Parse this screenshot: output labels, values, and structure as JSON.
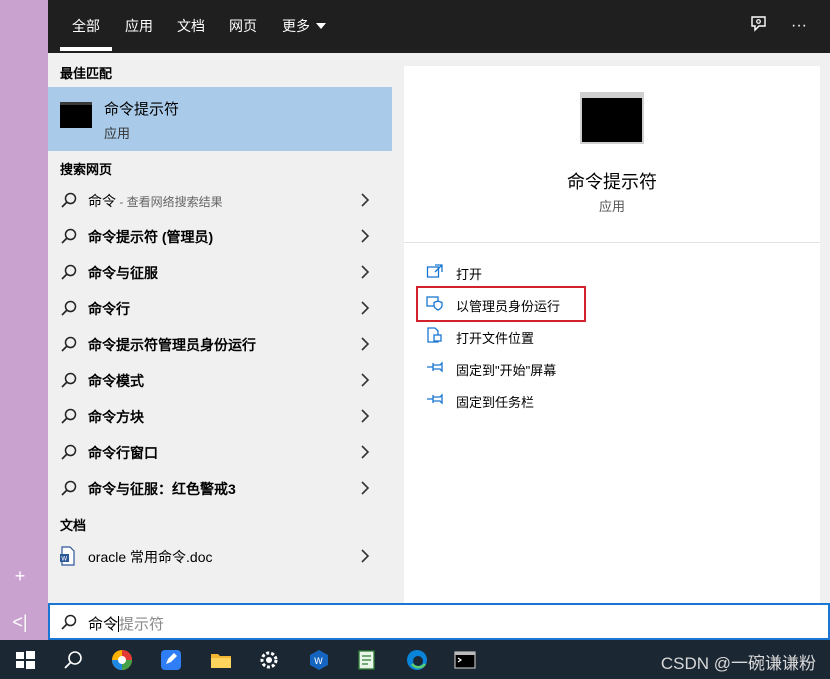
{
  "tabs": [
    {
      "label": "全部",
      "active": true
    },
    {
      "label": "应用"
    },
    {
      "label": "文档"
    },
    {
      "label": "网页"
    },
    {
      "label": "更多"
    }
  ],
  "top_icons": [
    "feedback-icon",
    "more-options-icon"
  ],
  "more_label": "···",
  "sections": {
    "best_match": "最佳匹配",
    "web": "搜索网页",
    "docs": "文档"
  },
  "best_match": {
    "title": "命令提示符",
    "subtitle": "应用"
  },
  "web_results": [
    {
      "text": "命令",
      "hint": " - 查看网络搜索结果"
    },
    {
      "text": "命令提示符 (管理员)"
    },
    {
      "text": "命令与征服"
    },
    {
      "text": "命令行"
    },
    {
      "text": "命令提示符管理员身份运行"
    },
    {
      "text": "命令模式"
    },
    {
      "text": "命令方块"
    },
    {
      "text": "命令行窗口"
    },
    {
      "text": "命令与征服：红色警戒3"
    }
  ],
  "documents": [
    {
      "text": "oracle 常用命令.doc"
    }
  ],
  "preview": {
    "title": "命令提示符",
    "subtitle": "应用"
  },
  "actions": [
    {
      "label": "打开",
      "icon": "open-icon"
    },
    {
      "label": "以管理员身份运行",
      "icon": "run-as-admin-icon",
      "highlighted": true
    },
    {
      "label": "打开文件位置",
      "icon": "file-location-icon"
    },
    {
      "label": "固定到\"开始\"屏幕",
      "icon": "pin-icon"
    },
    {
      "label": "固定到任务栏",
      "icon": "pin-icon"
    }
  ],
  "search": {
    "typed": "命令",
    "suggestion": "提示符"
  },
  "watermark": "CSDN @一碗谦谦粉",
  "colors": {
    "accent": "#1976d2",
    "selected": "#a9cbe9",
    "highlight": "#d3232a",
    "topbar": "#1f1f1f"
  }
}
